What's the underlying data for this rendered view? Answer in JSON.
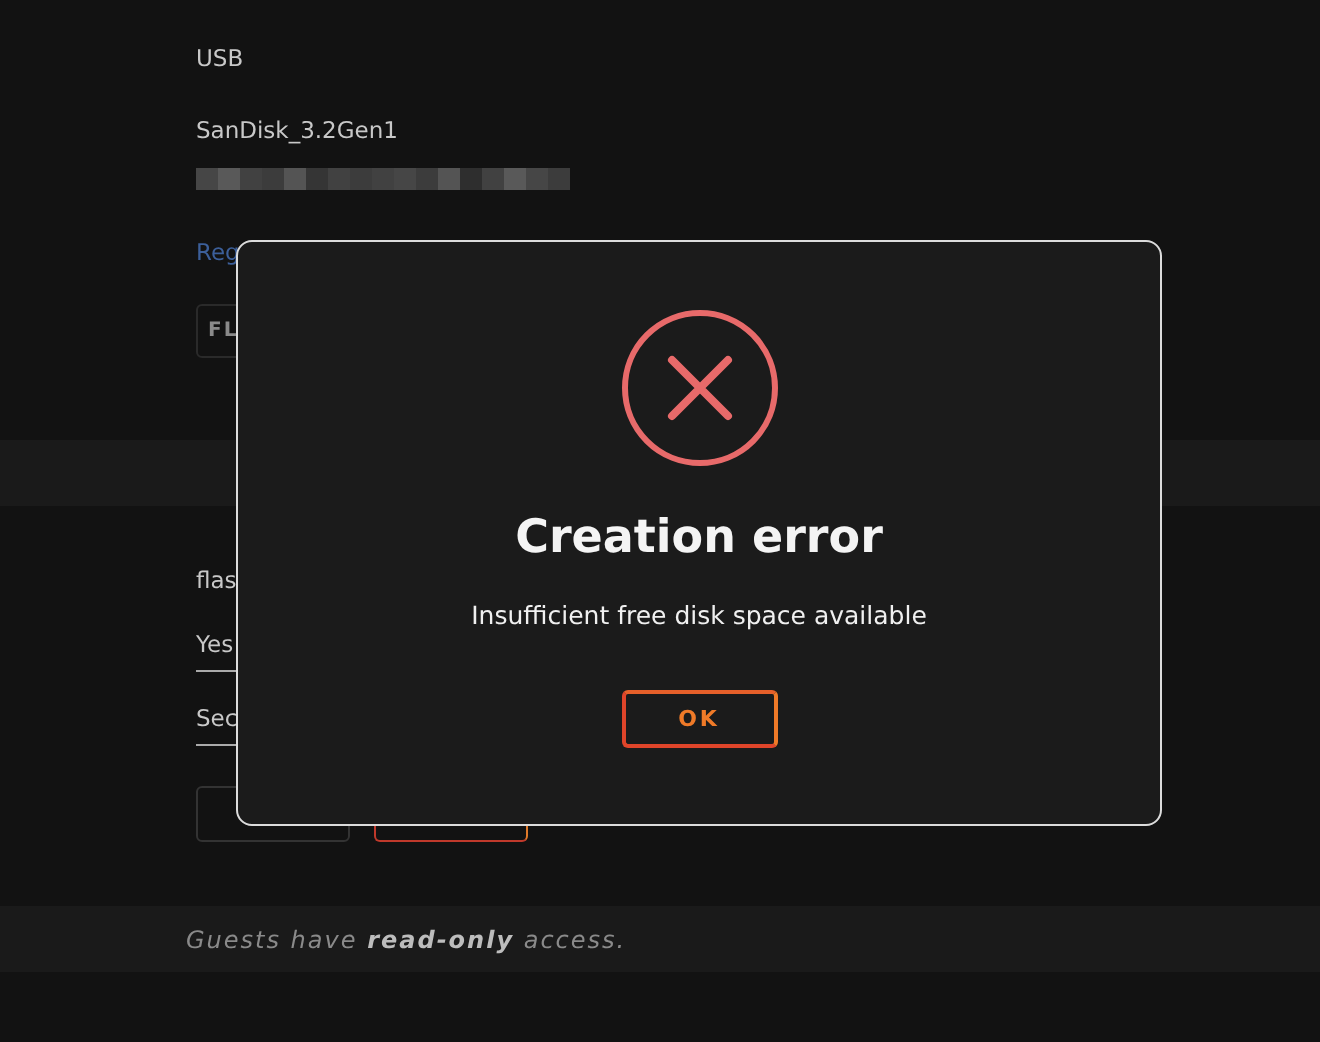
{
  "background": {
    "device_type": "USB",
    "device_name": "SanDisk_3.2Gen1",
    "link": "Reg",
    "button": "FL",
    "label": "flas",
    "fields": [
      {
        "value": "Yes"
      },
      {
        "value": "Sec"
      }
    ],
    "buttons": [
      {
        "kind": "secondary"
      },
      {
        "kind": "primary"
      }
    ]
  },
  "footer": {
    "text": "Guests have **read-only** access."
  },
  "dialog": {
    "title": "Creation error",
    "message": "Insufficient free disk space available",
    "button": "OK"
  }
}
